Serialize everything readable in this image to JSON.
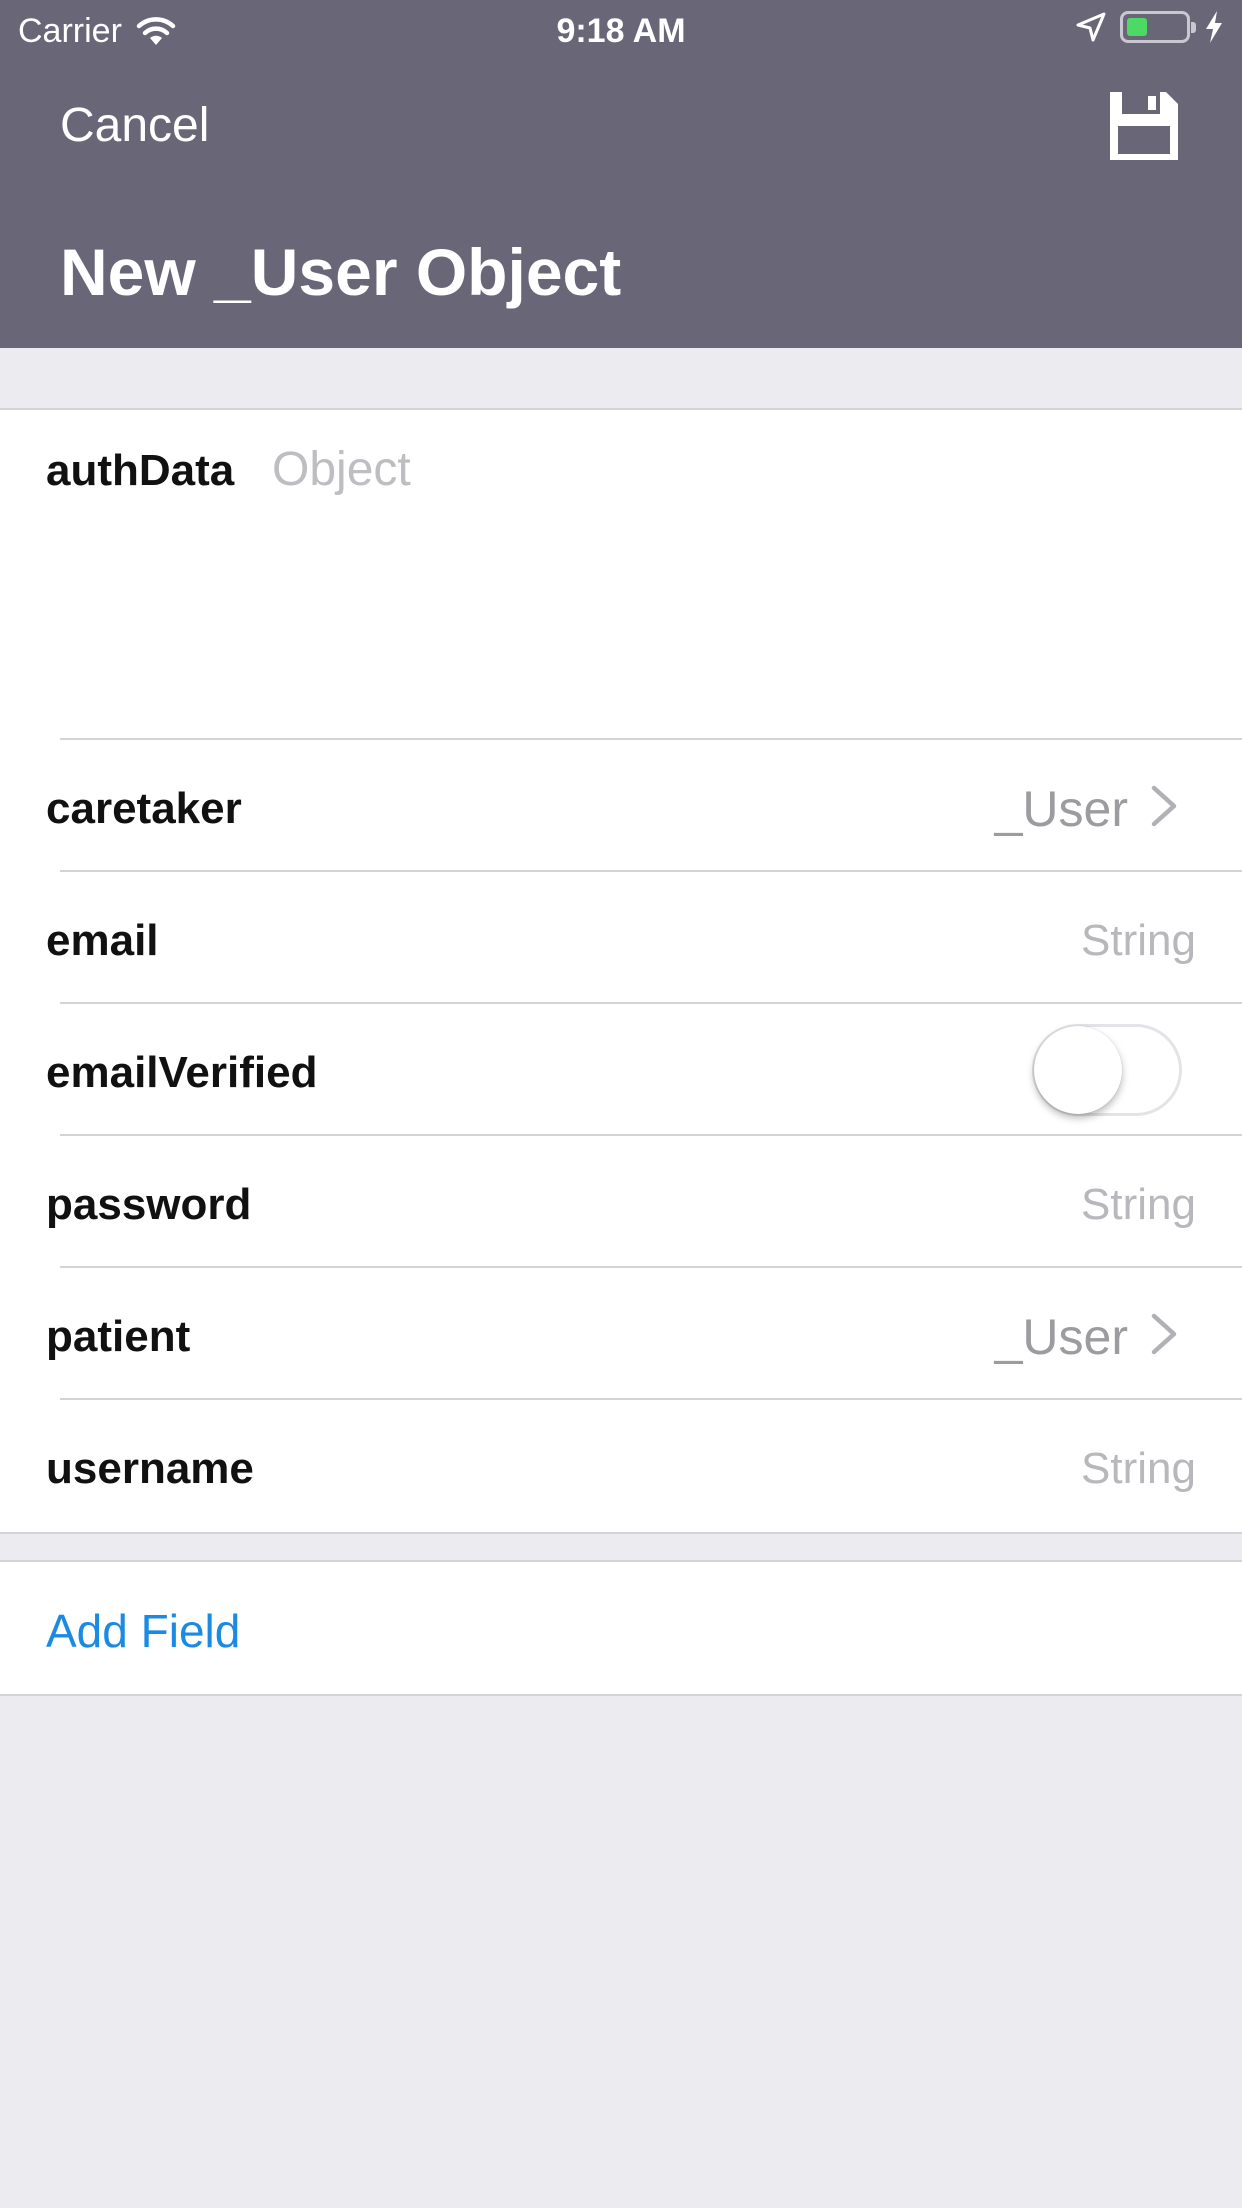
{
  "status_bar": {
    "carrier": "Carrier",
    "time": "9:18 AM",
    "icons": [
      "wifi-icon",
      "location-arrow-icon",
      "battery-icon",
      "charging-bolt-icon"
    ],
    "battery_color": "#4cd964"
  },
  "nav": {
    "cancel_label": "Cancel",
    "save_icon": "floppy-disk-save-icon",
    "title": "New _User Object",
    "bar_color": "#686677"
  },
  "fields": {
    "authData": {
      "label": "authData",
      "placeholder": "Object"
    },
    "caretaker": {
      "label": "caretaker",
      "value": "_User"
    },
    "email": {
      "label": "email",
      "placeholder": "String"
    },
    "emailVerified": {
      "label": "emailVerified",
      "value": false
    },
    "password": {
      "label": "password",
      "placeholder": "String"
    },
    "patient": {
      "label": "patient",
      "value": "_User"
    },
    "username": {
      "label": "username",
      "placeholder": "String"
    }
  },
  "add_field": {
    "label": "Add Field",
    "color": "#1b8ae3"
  }
}
